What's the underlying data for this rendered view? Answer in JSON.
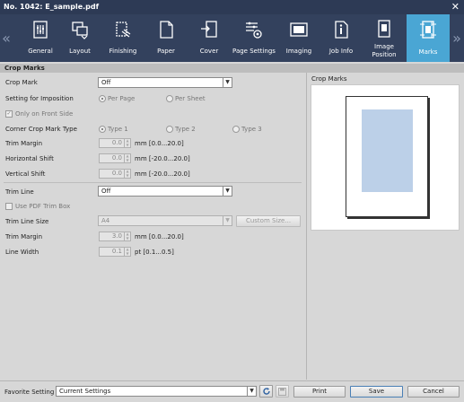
{
  "window": {
    "title": "No. 1042: E_sample.pdf",
    "close_glyph": "✕"
  },
  "toolbar": {
    "left_arrow": "«",
    "right_arrow": "»",
    "items": [
      {
        "label": "General",
        "icon": "general-icon"
      },
      {
        "label": "Layout",
        "icon": "layout-icon"
      },
      {
        "label": "Finishing",
        "icon": "finishing-icon"
      },
      {
        "label": "Paper",
        "icon": "paper-icon"
      },
      {
        "label": "Cover",
        "icon": "cover-icon"
      },
      {
        "label": "Page Settings",
        "icon": "page-settings-icon"
      },
      {
        "label": "Imaging",
        "icon": "imaging-icon"
      },
      {
        "label": "Job Info",
        "icon": "job-info-icon"
      },
      {
        "label": "Image Position",
        "icon": "image-position-icon"
      },
      {
        "label": "Marks",
        "icon": "marks-icon",
        "active": true
      }
    ]
  },
  "panel": {
    "title": "Crop Marks"
  },
  "form": {
    "crop_mark": {
      "label": "Crop Mark",
      "value": "Off"
    },
    "imposition": {
      "label": "Setting for Imposition",
      "opt1": "Per Page",
      "opt2": "Per Sheet",
      "selected": "Per Page"
    },
    "front_side": {
      "label": "Only on Front Side",
      "checked": true
    },
    "corner": {
      "label": "Corner Crop Mark Type",
      "opt1": "Type 1",
      "opt2": "Type 2",
      "opt3": "Type 3",
      "selected": "Type 1"
    },
    "trim_margin": {
      "label": "Trim Margin",
      "value": "0.0",
      "unit": "mm [0.0...20.0]"
    },
    "h_shift": {
      "label": "Horizontal Shift",
      "value": "0.0",
      "unit": "mm [-20.0...20.0]"
    },
    "v_shift": {
      "label": "Vertical Shift",
      "value": "0.0",
      "unit": "mm [-20.0...20.0]"
    },
    "trim_line": {
      "label": "Trim Line",
      "value": "Off"
    },
    "pdf_trim": {
      "label": "Use PDF Trim Box",
      "checked": false
    },
    "trim_size": {
      "label": "Trim Line Size",
      "value": "A4",
      "custom_button": "Custom Size..."
    },
    "trim_margin2": {
      "label": "Trim Margin",
      "value": "3.0",
      "unit": "mm [0.0...20.0]"
    },
    "line_width": {
      "label": "Line Width",
      "value": "0.1",
      "unit": "pt [0.1...0.5]"
    }
  },
  "preview": {
    "title": "Crop Marks"
  },
  "bottom": {
    "favorite_label": "Favorite Setting",
    "favorite_value": "Current Settings",
    "print": "Print",
    "save": "Save",
    "cancel": "Cancel"
  },
  "colors": {
    "titlebar": "#2d3a55",
    "toolbar": "#33415d",
    "active_tab": "#4aa6d4",
    "preview_image": "#bcd0e8"
  }
}
